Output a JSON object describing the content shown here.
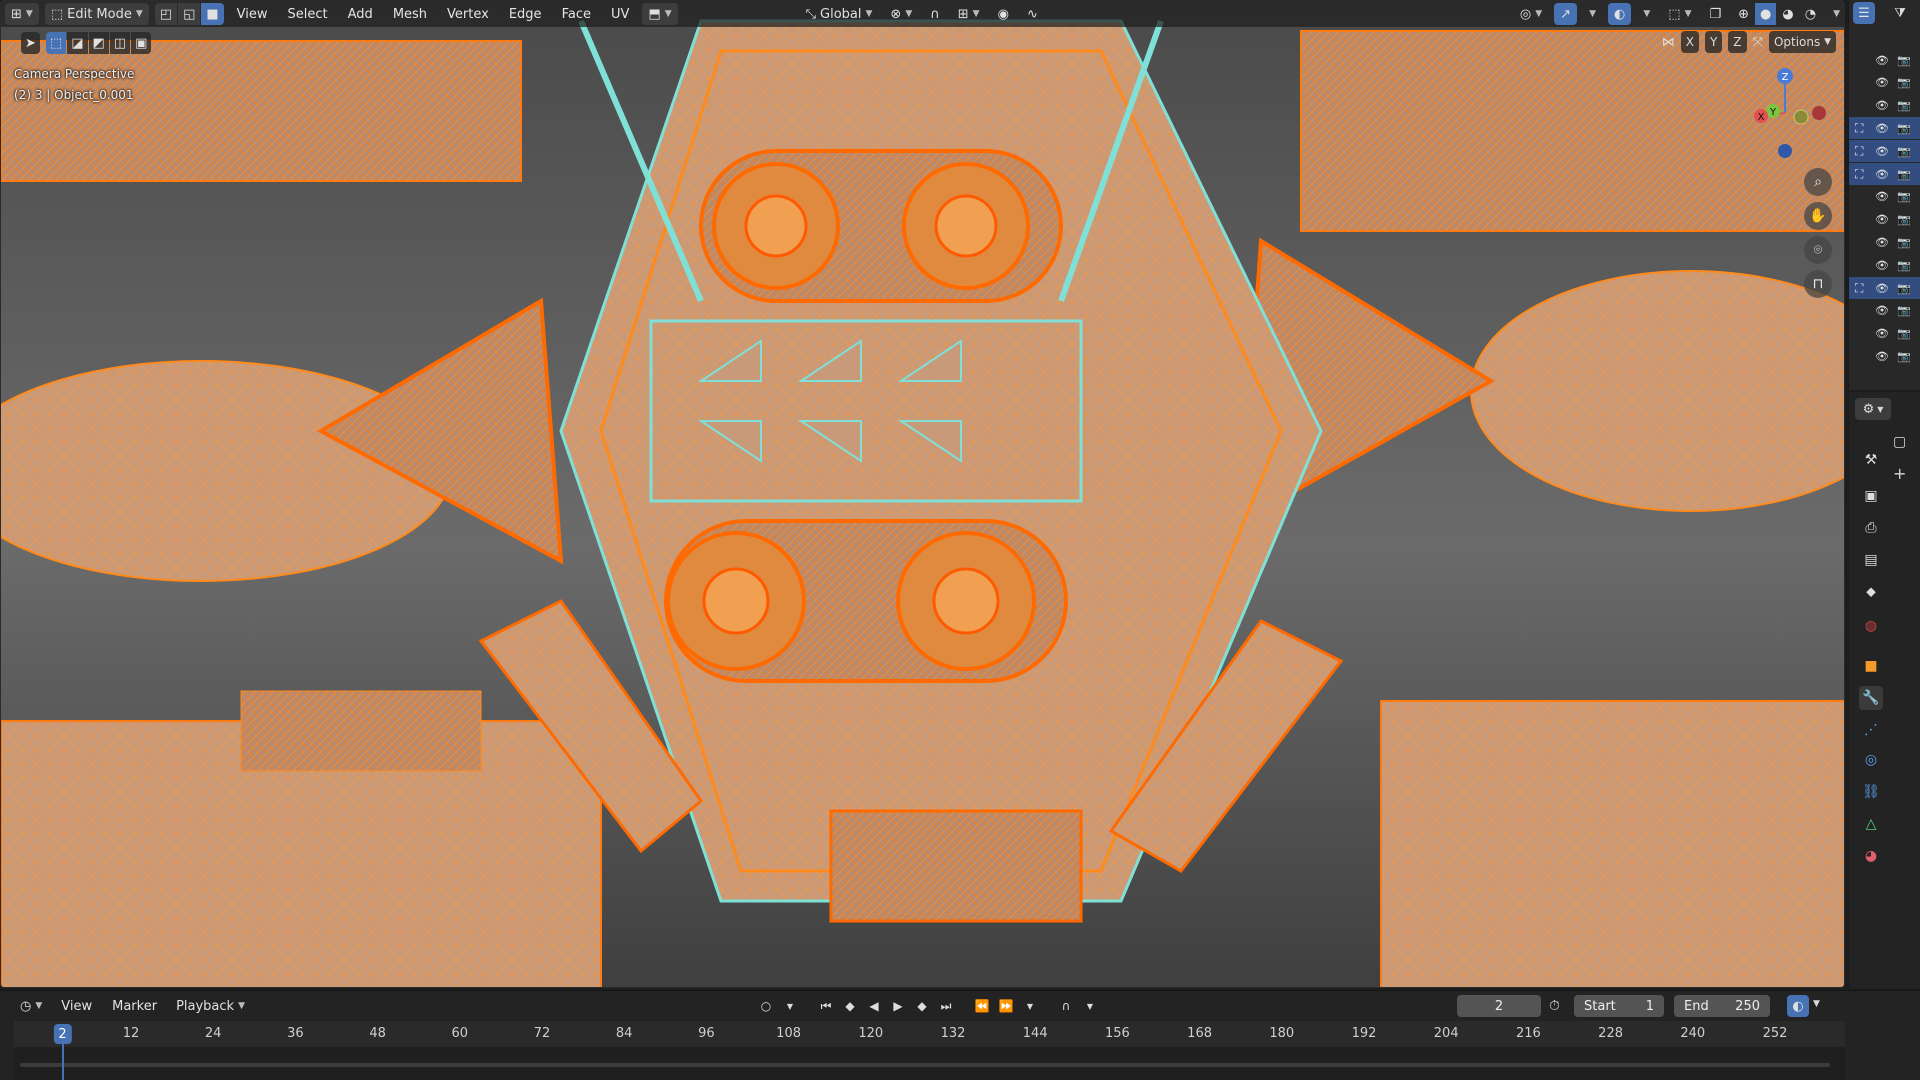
{
  "header": {
    "editor_type_icon": "3d-viewport-icon",
    "mode_label": "Edit Mode",
    "menus": [
      "View",
      "Select",
      "Add",
      "Mesh",
      "Vertex",
      "Edge",
      "Face",
      "UV"
    ],
    "transform_orientation": "Global"
  },
  "overlay": {
    "camera_label": "Camera Perspective",
    "object_label": "(2) 3 | Object_0.001",
    "axis_labels": [
      "X",
      "Y",
      "Z"
    ],
    "options_label": "Options"
  },
  "gizmo": {
    "z": "Z",
    "y": "Y",
    "x": "X"
  },
  "outliner": {
    "rows": 14,
    "selected_rows": [
      3,
      4,
      5,
      10
    ]
  },
  "properties": {
    "tabs": [
      "tool-icon",
      "render-icon",
      "output-icon",
      "view-layer-icon",
      "scene-icon",
      "world-icon",
      "object-icon",
      "modifier-icon",
      "particles-icon",
      "physics-icon",
      "constraints-icon",
      "data-icon",
      "material-icon"
    ],
    "active_tab": "modifier-icon"
  },
  "timeline": {
    "menus": [
      "View",
      "Marker",
      "Playback"
    ],
    "current_frame": "2",
    "start_label": "Start",
    "start_value": "1",
    "end_label": "End",
    "end_value": "250",
    "ticks": [
      "12",
      "24",
      "36",
      "48",
      "60",
      "72",
      "84",
      "96",
      "108",
      "120",
      "132",
      "144",
      "156",
      "168",
      "180",
      "192",
      "204",
      "216",
      "228",
      "240",
      "252"
    ]
  },
  "colors": {
    "accent": "#4772b3",
    "mesh_fill": "#c99a7a",
    "wire_orange": "#ff8a1c",
    "wire_cyan": "#7fe0d8"
  }
}
